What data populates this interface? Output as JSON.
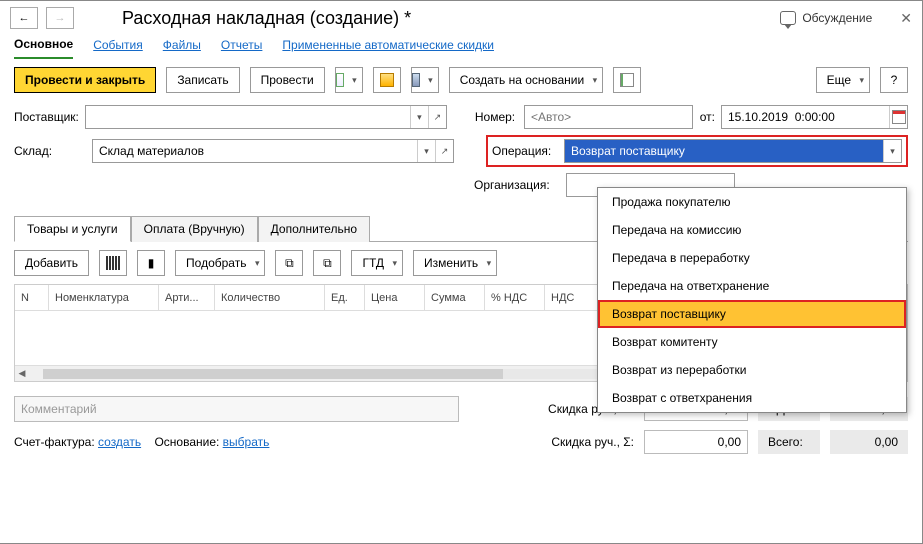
{
  "header": {
    "title": "Расходная накладная (создание) *",
    "discuss_label": "Обсуждение"
  },
  "main_nav": {
    "active": "Основное",
    "links": [
      "События",
      "Файлы",
      "Отчеты",
      "Примененные автоматические скидки"
    ]
  },
  "toolbar": {
    "post_close": "Провести и закрыть",
    "save": "Записать",
    "post": "Провести",
    "create_based": "Создать на основании",
    "more": "Еще",
    "help": "?"
  },
  "form": {
    "supplier_label": "Поставщик:",
    "supplier_value": "",
    "number_label": "Номер:",
    "number_placeholder": "<Авто>",
    "from_label": "от:",
    "date_value": "15.10.2019  0:00:00",
    "warehouse_label": "Склад:",
    "warehouse_value": "Склад материалов",
    "operation_label": "Операция:",
    "operation_value": "Возврат поставщику",
    "org_label": "Организация:"
  },
  "operation_dropdown": [
    "Продажа покупателю",
    "Передача на комиссию",
    "Передача в переработку",
    "Передача на ответхранение",
    "Возврат поставщику",
    "Возврат комитенту",
    "Возврат из переработки",
    "Возврат с ответхранения"
  ],
  "operation_selected_index": 4,
  "sub_tabs": [
    "Товары и услуги",
    "Оплата (Вручную)",
    "Дополнительно"
  ],
  "grid_toolbar": {
    "add": "Добавить",
    "pick": "Подобрать",
    "gtd": "ГТД",
    "change": "Изменить"
  },
  "grid_columns": [
    "N",
    "Номенклатура",
    "Арти...",
    "Количество",
    "Ед.",
    "Цена",
    "Сумма",
    "% НДС",
    "НДС"
  ],
  "footer": {
    "comment_placeholder": "Комментарий",
    "discount_pct_label": "Скидка руч., %:",
    "discount_pct_value": "0,00",
    "discount_sum_label": "Скидка руч., Σ:",
    "discount_sum_value": "0,00",
    "vat_label": "НДС:",
    "vat_value": "0,00",
    "total_label": "Всего:",
    "total_value": "0,00",
    "invoice_label": "Счет-фактура:",
    "invoice_link": "создать",
    "basis_label": "Основание:",
    "basis_link": "выбрать"
  }
}
